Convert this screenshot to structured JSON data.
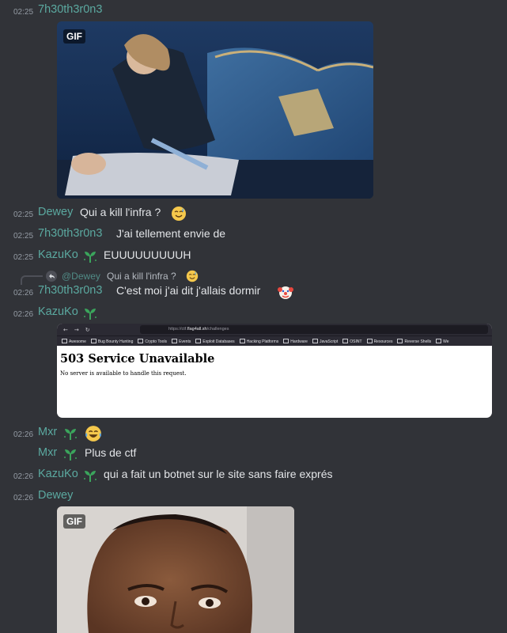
{
  "messages": [
    {
      "time": "02:25",
      "user": "7h30th3r0n3"
    },
    {
      "time": "02:25",
      "user": "Dewey",
      "text": "Qui a kill l'infra ?"
    },
    {
      "time": "02:25",
      "user": "7h30th3r0n3",
      "text": "J'ai tellement envie de"
    },
    {
      "time": "02:25",
      "user": "KazuKo",
      "text": "EUUUUUUUUUH"
    },
    {
      "time": "02:26",
      "user": "7h30th3r0n3",
      "text": "C'est moi j'ai dit j'allais dormir"
    },
    {
      "time": "02:26",
      "user": "KazuKo"
    },
    {
      "time": "02:26",
      "user": "Mxr"
    },
    {
      "time": "",
      "user": "Mxr",
      "text": "Plus de ctf"
    },
    {
      "time": "02:26",
      "user": "KazuKo",
      "text": "qui a fait un botnet sur le site sans faire exprés"
    },
    {
      "time": "02:26",
      "user": "Dewey"
    }
  ],
  "reply": {
    "mention": "@Dewey",
    "text": "Qui a kill l'infra ?"
  },
  "gif_label": "GIF",
  "screenshot": {
    "url_prefix": "https://ctf.",
    "url_host": "flag4all.sh",
    "url_path": "/challenges",
    "bookmarks": [
      "Awesome",
      "Bug Bounty Hunting",
      "Crypto Tools",
      "Events",
      "Exploit Databases",
      "Hacking Platforms",
      "Hardware",
      "JavaScript",
      "OSINT",
      "Resources",
      "Reverse Shells",
      "We"
    ],
    "heading": "503 Service Unavailable",
    "body": "No server is available to handle this request."
  },
  "colors": {
    "background": "#313338",
    "username": "#5ba9a0",
    "timestamp": "#949ba4",
    "text": "#e3e5e8"
  },
  "icons": [
    "sprout-badge-icon",
    "sweat-smile-emoji",
    "clown-emoji",
    "joy-emoji",
    "reply-arrow-icon"
  ]
}
